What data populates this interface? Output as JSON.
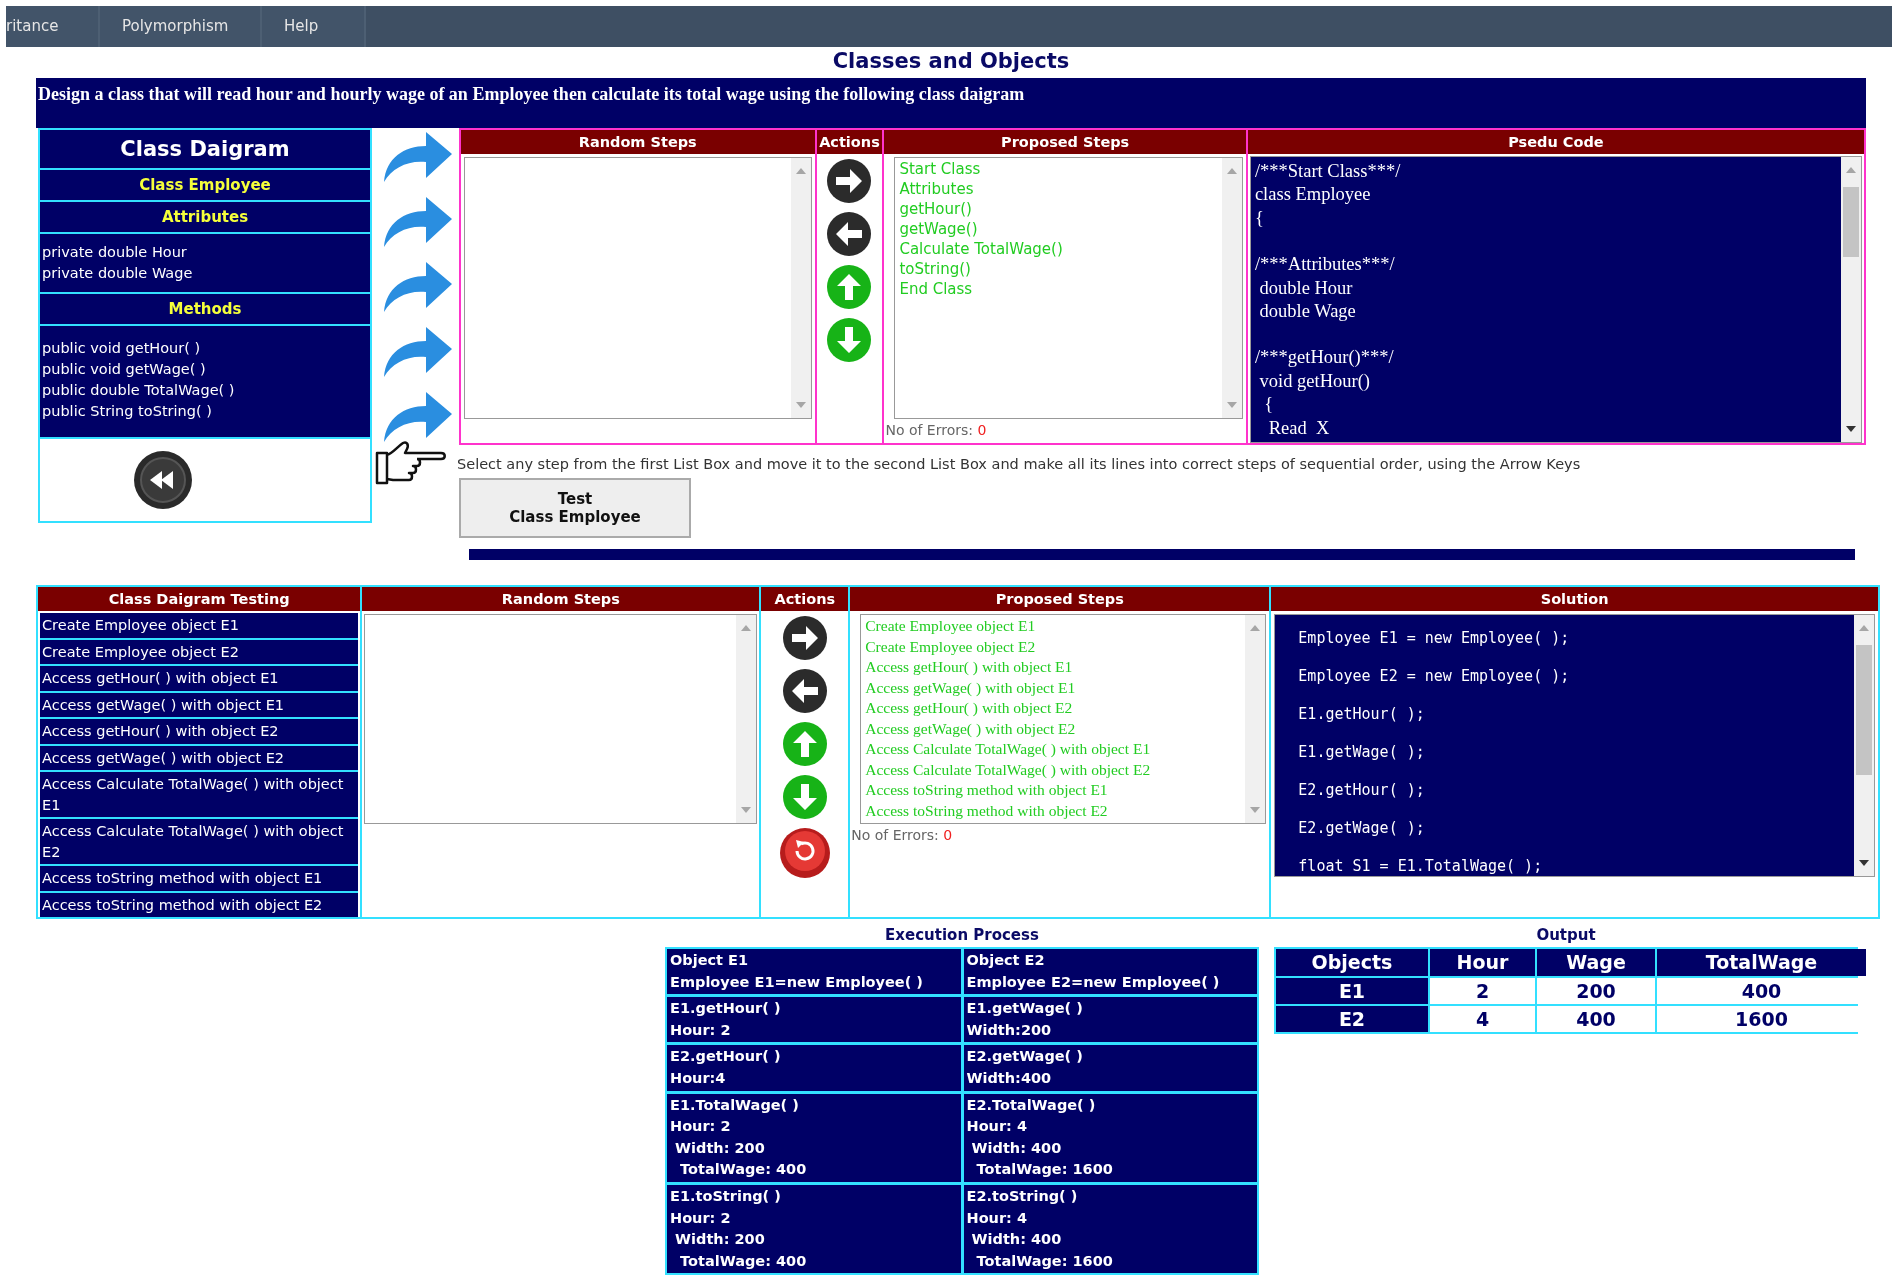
{
  "menu": [
    {
      "label": "ritance"
    },
    {
      "label": "Polymorphism"
    },
    {
      "label": "Help"
    }
  ],
  "title": "Classes and Objects",
  "banner": "Design a class that will read hour and hourly wage of an Employee then calculate its total wage using the following class daigram",
  "class_diagram": {
    "title": "Class Daigram",
    "class_name": "Class Employee",
    "attributes_heading": "Attributes",
    "attributes": [
      "private double Hour",
      "private double Wage"
    ],
    "methods_heading": "Methods",
    "methods": [
      "public void getHour( )",
      "public void getWage( )",
      "public double TotalWage( )",
      "public String toString( )"
    ]
  },
  "class_exercise": {
    "columns": [
      "Random Steps",
      "Actions",
      "Proposed Steps",
      "Psedu Code"
    ],
    "proposed_steps": [
      "Start Class",
      "Attributes",
      "getHour()",
      "getWage()",
      "Calculate TotalWage()",
      "toString()",
      "End Class"
    ],
    "errors_label": "No of Errors:",
    "errors_count": "0",
    "pseudo_code": [
      [
        "/***Start Class***/",
        "class Employee",
        "{"
      ],
      [
        "/***Attributes***/",
        " double Hour",
        " double Wage"
      ],
      [
        "/***getHour()***/",
        " void getHour()",
        "  {",
        "   Read  X"
      ]
    ]
  },
  "instruction": "Select any step from the first List Box and move it to the second List Box and make all its lines into correct steps of sequential order, using the Arrow Keys",
  "test_button": [
    "Test",
    "Class Employee"
  ],
  "testing_exercise": {
    "columns": [
      "Class Daigram Testing",
      "Random Steps",
      "Actions",
      "Proposed Steps",
      "Solution"
    ],
    "items": [
      "Create Employee object E1",
      "Create Employee object E2",
      "Access getHour( ) with object E1",
      "Access getWage( ) with object E1",
      "Access getHour( ) with object E2",
      "Access getWage( ) with object E2",
      "Access Calculate TotalWage( ) with object E1",
      "Access Calculate TotalWage( ) with object E2",
      "Access toString method with object E1",
      "Access toString method with object E2"
    ],
    "proposed_steps": [
      "Create Employee object E1",
      "Create Employee object E2",
      "Access getHour( ) with object E1",
      "Access getWage( ) with object E1",
      "Access getHour( ) with object E2",
      "Access getWage( ) with object E2",
      "Access Calculate TotalWage( ) with object E1",
      "Access Calculate TotalWage( ) with object E2",
      "Access toString method with object E1",
      "Access toString method with object E2"
    ],
    "errors_label": "No of Errors:",
    "errors_count": "0",
    "solution": [
      "Employee E1 = new Employee( );",
      "Employee E2 = new Employee( );",
      "E1.getHour( );",
      "E1.getWage( );",
      "E2.getHour( );",
      "E2.getWage( );",
      "float S1 = E1.TotalWage( );"
    ]
  },
  "execution": {
    "title": "Execution Process",
    "cells": [
      [
        "Object E1",
        "Employee E1=new Employee( )"
      ],
      [
        "Object E2",
        "Employee E2=new Employee( )"
      ],
      [
        "E1.getHour( )",
        "Hour: 2"
      ],
      [
        "E1.getWage( )",
        "Width:200"
      ],
      [
        "E2.getHour( )",
        "Hour:4"
      ],
      [
        "E2.getWage( )",
        "Width:400"
      ],
      [
        "E1.TotalWage( )",
        "Hour: 2",
        " Width: 200",
        "  TotalWage: 400"
      ],
      [
        "E2.TotalWage( )",
        "Hour: 4",
        " Width: 400",
        "  TotalWage: 1600"
      ],
      [
        "E1.toString( )",
        "Hour: 2",
        " Width: 200",
        "  TotalWage: 400"
      ],
      [
        "E2.toString( )",
        "Hour: 4",
        " Width: 400",
        "  TotalWage: 1600"
      ]
    ]
  },
  "output": {
    "title": "Output",
    "columns": [
      "Objects",
      "Hour",
      "Wage",
      "TotalWage"
    ],
    "rows": [
      [
        "E1",
        "2",
        "200",
        "400"
      ],
      [
        "E2",
        "4",
        "400",
        "1600"
      ]
    ]
  }
}
